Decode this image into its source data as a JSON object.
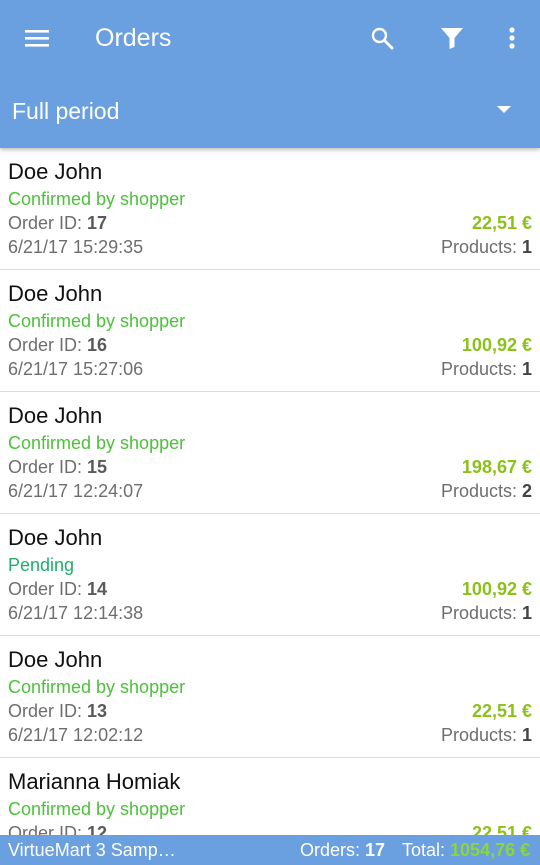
{
  "app": {
    "title": "Orders",
    "period": "Full period",
    "colors": {
      "primary": "#6a9fe0",
      "confirmed": "#4cc13a",
      "pending": "#1fae6e",
      "amount": "#8bc219"
    },
    "icons": {
      "menu": "hamburger-menu-icon",
      "search": "search-icon",
      "filter": "filter-icon",
      "more": "more-vert-icon",
      "period": "dropdown-caret-icon"
    }
  },
  "labels": {
    "order_id": "Order ID: ",
    "products": "Products: "
  },
  "orders": [
    {
      "customer": "Doe John",
      "status": "Confirmed by shopper",
      "status_type": "confirmed",
      "order_id": "17",
      "date": "6/21/17 15:29:35",
      "amount": "22,51 €",
      "products": "1"
    },
    {
      "customer": "Doe John",
      "status": "Confirmed by shopper",
      "status_type": "confirmed",
      "order_id": "16",
      "date": "6/21/17 15:27:06",
      "amount": "100,92 €",
      "products": "1"
    },
    {
      "customer": "Doe John",
      "status": "Confirmed by shopper",
      "status_type": "confirmed",
      "order_id": "15",
      "date": "6/21/17 12:24:07",
      "amount": "198,67 €",
      "products": "2"
    },
    {
      "customer": "Doe John",
      "status": "Pending",
      "status_type": "pending",
      "order_id": "14",
      "date": "6/21/17 12:14:38",
      "amount": "100,92 €",
      "products": "1"
    },
    {
      "customer": "Doe John",
      "status": "Confirmed by shopper",
      "status_type": "confirmed",
      "order_id": "13",
      "date": "6/21/17 12:02:12",
      "amount": "22,51 €",
      "products": "1"
    },
    {
      "customer": "Marianna Homiak",
      "status": "Confirmed by shopper",
      "status_type": "confirmed",
      "order_id": "12",
      "date": "",
      "amount": "22,51 €",
      "products": ""
    }
  ],
  "footer": {
    "shop": "VirtueMart 3 Samp…",
    "orders_label": "Orders: ",
    "orders_count": "17",
    "total_label": "Total: ",
    "total_value": "1054,76 €"
  }
}
